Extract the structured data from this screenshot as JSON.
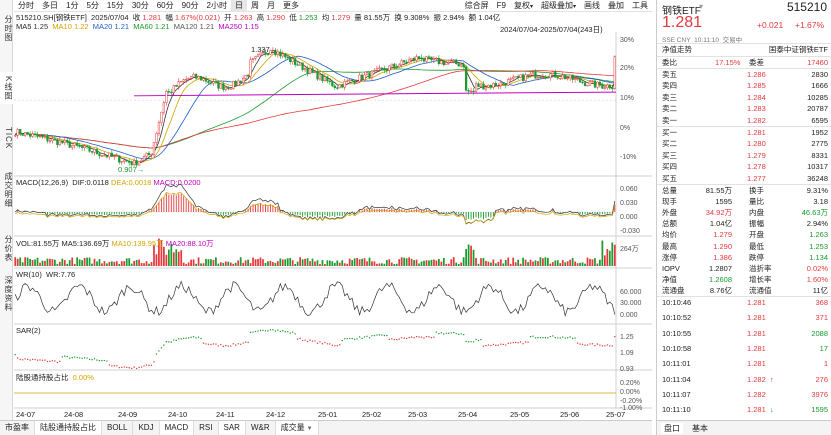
{
  "vtabs": [
    "分时图",
    "K线图",
    "TICK",
    "成交明细",
    "分价表",
    "深度资料"
  ],
  "toolbar": {
    "periods": [
      "分时",
      "多日",
      "1分",
      "5分",
      "15分",
      "30分",
      "60分",
      "90分",
      "2小时",
      "日",
      "周",
      "月",
      "更多"
    ],
    "active_period": "日",
    "tools": [
      "综合屏",
      "F9",
      "画线",
      "叠加",
      "工具"
    ],
    "tools_dd": [
      "复权",
      "超级叠加"
    ]
  },
  "info": {
    "code": "515210.SH[钢铁ETF]",
    "date": "2025/07/04",
    "close_label": "收",
    "close": "1.281",
    "change_label": "幅",
    "change": "1.67%(0.021)",
    "open_label": "开",
    "open": "1.263",
    "high_label": "高",
    "high": "1.290",
    "low_label": "低",
    "low": "1.253",
    "avg_label": "均",
    "avg": "1.279",
    "volume_label": "量",
    "volume": "81.55万",
    "turnover_label": "换",
    "turnover": "9.308%",
    "amp_label": "振",
    "amp": "2.94%",
    "amount_label": "额",
    "amount": "1.04亿"
  },
  "ma": {
    "items": [
      {
        "label": "MA5",
        "value": "1.25",
        "color": "#333333"
      },
      {
        "label": "MA10",
        "value": "1.22",
        "color": "#d4a300"
      },
      {
        "label": "MA20",
        "value": "1.21",
        "color": "#1f5cc8"
      },
      {
        "label": "MA60",
        "value": "1.21",
        "color": "#1a9b2c"
      },
      {
        "label": "MA120",
        "value": "1.21",
        "color": "#555555"
      },
      {
        "label": "MA250",
        "value": "1.15",
        "color": "#c000c0"
      }
    ]
  },
  "range_label": "2024/07/04-2025/07/04(243日)",
  "kline": {
    "high_mark": "1.337",
    "low_mark": "0.907",
    "axis": [
      "30%",
      "20%",
      "10%",
      "0%",
      "-10%"
    ]
  },
  "macd": {
    "title": "MACD(12,26,9)",
    "dif": "DIF:0.0118",
    "dea": "DEA:0.0018",
    "macd": "MACD:0.0200",
    "axis": [
      "0.060",
      "0.030",
      "0.000",
      "-0.030"
    ]
  },
  "vol": {
    "title": "VOL:81.55万",
    "ma5": "MA5:136.69万",
    "ma10": "MA10:139.95万",
    "ma20": "MA20:88.10万",
    "axis": [
      "264万"
    ]
  },
  "wr": {
    "title": "WR(10)",
    "value": "WR:7.76",
    "axis": [
      "60.000",
      "30.000",
      "0.000"
    ]
  },
  "sar": {
    "title": "SAR(2)",
    "axis": [
      "1.25",
      "1.09",
      "0.93"
    ]
  },
  "hk": {
    "title": "陆股通持股占比",
    "value": "0.00%",
    "axis": [
      "0.20%",
      "0.00%",
      "-0.20%",
      "-1.00%"
    ]
  },
  "xaxis": [
    "24-07",
    "24-08",
    "24-09",
    "24-10",
    "24-11",
    "24-12",
    "25-01",
    "25-02",
    "25-03",
    "25-04",
    "25-05",
    "25-06",
    "25-07"
  ],
  "btabs": [
    {
      "label": "市盈率",
      "active": false,
      "dd": false
    },
    {
      "label": "陆股通持股占比",
      "active": true,
      "dd": false
    },
    {
      "label": "BOLL",
      "active": false,
      "dd": false
    },
    {
      "label": "KDJ",
      "active": false,
      "dd": false
    },
    {
      "label": "MACD",
      "active": true,
      "dd": false
    },
    {
      "label": "RSI",
      "active": false,
      "dd": false
    },
    {
      "label": "SAR",
      "active": true,
      "dd": false
    },
    {
      "label": "W&R",
      "active": false,
      "dd": false
    },
    {
      "label": "成交量",
      "active": true,
      "dd": true
    }
  ],
  "right": {
    "name": "钢铁ETF",
    "code": "515210",
    "price": "1.281",
    "chg": "+0.021",
    "pct": "+1.67%",
    "market": "SSE CNY",
    "time": "10:11:10",
    "status": "交易中",
    "nav_label": "净值走势",
    "index_label": "国泰中证钢铁ETF",
    "weibi_label": "委比",
    "weibi": "17.15%",
    "weicha_label": "委差",
    "weicha": "17460",
    "sells": [
      {
        "label": "卖五",
        "price": "1.286",
        "vol": "2830"
      },
      {
        "label": "卖四",
        "price": "1.285",
        "vol": "1666"
      },
      {
        "label": "卖三",
        "price": "1.284",
        "vol": "10285"
      },
      {
        "label": "卖二",
        "price": "1.283",
        "vol": "20787"
      },
      {
        "label": "卖一",
        "price": "1.282",
        "vol": "6595"
      }
    ],
    "buys": [
      {
        "label": "买一",
        "price": "1.281",
        "vol": "1952"
      },
      {
        "label": "买二",
        "price": "1.280",
        "vol": "2775"
      },
      {
        "label": "买三",
        "price": "1.279",
        "vol": "8331"
      },
      {
        "label": "买四",
        "price": "1.278",
        "vol": "10317"
      },
      {
        "label": "买五",
        "price": "1.277",
        "vol": "36248"
      }
    ],
    "stats": [
      {
        "l1": "总量",
        "v1": "81.55万",
        "c1": "#222",
        "l2": "换手",
        "v2": "9.31%",
        "c2": "#222"
      },
      {
        "l1": "现手",
        "v1": "1595",
        "c1": "#222",
        "l2": "量比",
        "v2": "3.18",
        "c2": "#222"
      },
      {
        "l1": "外盘",
        "v1": "34.92万",
        "c1": "#e4393c",
        "l2": "内盘",
        "v2": "46.63万",
        "c2": "#1a9b2c"
      },
      {
        "l1": "总额",
        "v1": "1.04亿",
        "c1": "#222",
        "l2": "振幅",
        "v2": "2.94%",
        "c2": "#222"
      },
      {
        "l1": "均价",
        "v1": "1.279",
        "c1": "#e4393c",
        "l2": "开盘",
        "v2": "1.263",
        "c2": "#1a9b2c"
      },
      {
        "l1": "最高",
        "v1": "1.290",
        "c1": "#e4393c",
        "l2": "最低",
        "v2": "1.253",
        "c2": "#1a9b2c"
      },
      {
        "l1": "涨停",
        "v1": "1.386",
        "c1": "#e4393c",
        "l2": "跌停",
        "v2": "1.134",
        "c2": "#1a9b2c"
      },
      {
        "l1": "IOPV",
        "v1": "1.2807",
        "c1": "#222",
        "l2": "溢折率",
        "v2": "0.02%",
        "c2": "#e4393c"
      },
      {
        "l1": "净值",
        "v1": "1.2608",
        "c1": "#1a9b2c",
        "l2": "增长率",
        "v2": "1.60%",
        "c2": "#e4393c"
      },
      {
        "l1": "流通盘",
        "v1": "8.76亿",
        "c1": "#222",
        "l2": "流通值",
        "v2": "11亿",
        "c2": "#222"
      }
    ],
    "ticks": [
      {
        "time": "10:10:46",
        "price": "1.281",
        "vol": "368",
        "arrow": "",
        "vcolor": "#e4393c"
      },
      {
        "time": "10:10:52",
        "price": "1.281",
        "vol": "371",
        "arrow": "",
        "vcolor": "#e4393c"
      },
      {
        "time": "10:10:55",
        "price": "1.281",
        "vol": "2088",
        "arrow": "",
        "vcolor": "#1a9b2c"
      },
      {
        "time": "10:10:58",
        "price": "1.281",
        "vol": "17",
        "arrow": "",
        "vcolor": "#1a9b2c"
      },
      {
        "time": "10:11:01",
        "price": "1.281",
        "vol": "1",
        "arrow": "",
        "vcolor": "#e4393c"
      },
      {
        "time": "10:11:04",
        "price": "1.282",
        "vol": "276",
        "arrow": "↑",
        "vcolor": "#e4393c"
      },
      {
        "time": "10:11:07",
        "price": "1.282",
        "vol": "3976",
        "arrow": "",
        "vcolor": "#e4393c"
      },
      {
        "time": "10:11:10",
        "price": "1.281",
        "vol": "1595",
        "arrow": "↓",
        "vcolor": "#1a9b2c"
      }
    ],
    "bottom_tabs": [
      "盘口",
      "基本"
    ]
  }
}
